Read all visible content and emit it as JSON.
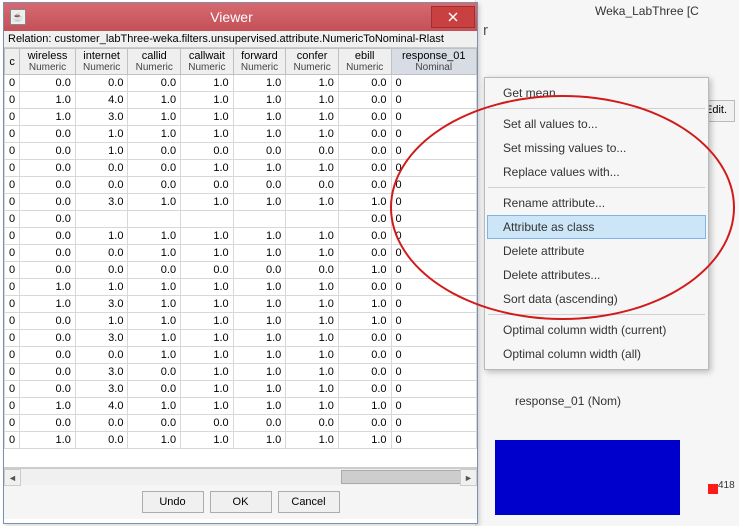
{
  "bg": {
    "title": "Weka_LabThree [C",
    "r": "r",
    "edit": "Edit.",
    "class_label": "response_01 (Nom)",
    "num418": "418"
  },
  "window": {
    "title": "Viewer",
    "relation": "Relation: customer_labThree-weka.filters.unsupervised.attribute.NumericToNominal-Rlast",
    "close": "×",
    "icon": "☕"
  },
  "columns": [
    {
      "name": "c",
      "type": ""
    },
    {
      "name": "wireless",
      "type": "Numeric"
    },
    {
      "name": "internet",
      "type": "Numeric"
    },
    {
      "name": "callid",
      "type": "Numeric"
    },
    {
      "name": "callwait",
      "type": "Numeric"
    },
    {
      "name": "forward",
      "type": "Numeric"
    },
    {
      "name": "confer",
      "type": "Numeric"
    },
    {
      "name": "ebill",
      "type": "Numeric"
    },
    {
      "name": "response_01",
      "type": "Nominal"
    }
  ],
  "rows": [
    [
      "0",
      "0.0",
      "0.0",
      "0.0",
      "1.0",
      "1.0",
      "1.0",
      "0.0",
      "0"
    ],
    [
      "0",
      "1.0",
      "4.0",
      "1.0",
      "1.0",
      "1.0",
      "1.0",
      "0.0",
      "0"
    ],
    [
      "0",
      "1.0",
      "3.0",
      "1.0",
      "1.0",
      "1.0",
      "1.0",
      "0.0",
      "0"
    ],
    [
      "0",
      "0.0",
      "1.0",
      "1.0",
      "1.0",
      "1.0",
      "1.0",
      "0.0",
      "0"
    ],
    [
      "0",
      "0.0",
      "1.0",
      "0.0",
      "0.0",
      "0.0",
      "0.0",
      "0.0",
      "0"
    ],
    [
      "0",
      "0.0",
      "0.0",
      "0.0",
      "1.0",
      "1.0",
      "1.0",
      "0.0",
      "0"
    ],
    [
      "0",
      "0.0",
      "0.0",
      "0.0",
      "0.0",
      "0.0",
      "0.0",
      "0.0",
      "0"
    ],
    [
      "0",
      "0.0",
      "3.0",
      "1.0",
      "1.0",
      "1.0",
      "1.0",
      "1.0",
      "0"
    ],
    [
      "0",
      "0.0",
      "",
      "",
      "",
      "",
      "",
      "0.0",
      "0"
    ],
    [
      "0",
      "0.0",
      "1.0",
      "1.0",
      "1.0",
      "1.0",
      "1.0",
      "0.0",
      "0"
    ],
    [
      "0",
      "0.0",
      "0.0",
      "1.0",
      "1.0",
      "1.0",
      "1.0",
      "0.0",
      "0"
    ],
    [
      "0",
      "0.0",
      "0.0",
      "0.0",
      "0.0",
      "0.0",
      "0.0",
      "1.0",
      "0"
    ],
    [
      "0",
      "1.0",
      "1.0",
      "1.0",
      "1.0",
      "1.0",
      "1.0",
      "0.0",
      "0"
    ],
    [
      "0",
      "1.0",
      "3.0",
      "1.0",
      "1.0",
      "1.0",
      "1.0",
      "1.0",
      "0"
    ],
    [
      "0",
      "0.0",
      "1.0",
      "1.0",
      "1.0",
      "1.0",
      "1.0",
      "1.0",
      "0"
    ],
    [
      "0",
      "0.0",
      "3.0",
      "1.0",
      "1.0",
      "1.0",
      "1.0",
      "0.0",
      "0"
    ],
    [
      "0",
      "0.0",
      "0.0",
      "1.0",
      "1.0",
      "1.0",
      "1.0",
      "0.0",
      "0"
    ],
    [
      "0",
      "0.0",
      "3.0",
      "0.0",
      "1.0",
      "1.0",
      "1.0",
      "0.0",
      "0"
    ],
    [
      "0",
      "0.0",
      "3.0",
      "0.0",
      "1.0",
      "1.0",
      "1.0",
      "0.0",
      "0"
    ],
    [
      "0",
      "1.0",
      "4.0",
      "1.0",
      "1.0",
      "1.0",
      "1.0",
      "1.0",
      "0"
    ],
    [
      "0",
      "0.0",
      "0.0",
      "0.0",
      "0.0",
      "0.0",
      "0.0",
      "0.0",
      "0"
    ],
    [
      "0",
      "1.0",
      "0.0",
      "1.0",
      "1.0",
      "1.0",
      "1.0",
      "1.0",
      "0"
    ]
  ],
  "buttons": {
    "undo": "Undo",
    "ok": "OK",
    "cancel": "Cancel"
  },
  "context_menu": {
    "items": [
      {
        "label": "Get mean...",
        "sep_after": true
      },
      {
        "label": "Set all values to..."
      },
      {
        "label": "Set missing values to..."
      },
      {
        "label": "Replace values with...",
        "sep_after": true
      },
      {
        "label": "Rename attribute..."
      },
      {
        "label": "Attribute as class",
        "hilite": true
      },
      {
        "label": "Delete attribute"
      },
      {
        "label": "Delete attributes..."
      },
      {
        "label": "Sort data (ascending)",
        "sep_after": true
      },
      {
        "label": "Optimal column width (current)"
      },
      {
        "label": "Optimal column width (all)"
      }
    ]
  }
}
